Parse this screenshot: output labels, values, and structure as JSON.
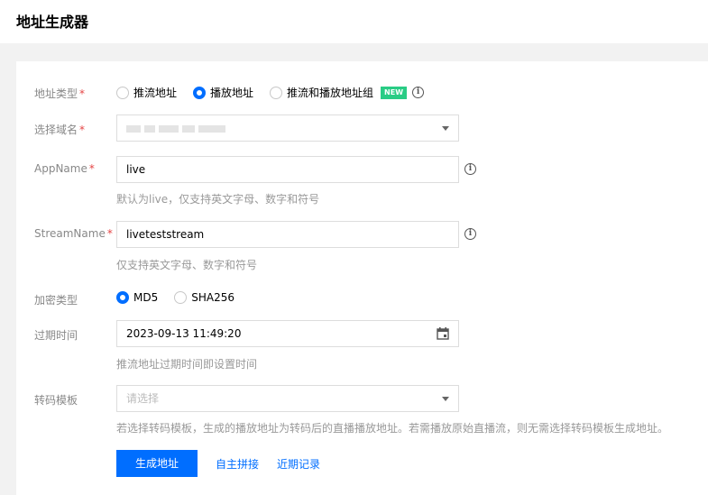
{
  "page": {
    "title": "地址生成器"
  },
  "form": {
    "address_type": {
      "label": "地址类型",
      "required_mark": "*",
      "options": [
        "推流地址",
        "播放地址",
        "推流和播放地址组"
      ],
      "selected": "播放地址",
      "new_badge": "NEW"
    },
    "domain": {
      "label": "选择域名",
      "required_mark": "*"
    },
    "app_name": {
      "label": "AppName",
      "required_mark": "*",
      "value": "live",
      "help": "默认为live，仅支持英文字母、数字和符号"
    },
    "stream_name": {
      "label": "StreamName",
      "required_mark": "*",
      "value": "liveteststream",
      "help": "仅支持英文字母、数字和符号"
    },
    "encryption": {
      "label": "加密类型",
      "options": [
        "MD5",
        "SHA256"
      ],
      "selected": "MD5"
    },
    "expire_time": {
      "label": "过期时间",
      "value": "2023-09-13 11:49:20",
      "help": "推流地址过期时间即设置时间"
    },
    "transcode_template": {
      "label": "转码模板",
      "placeholder": "请选择",
      "help": "若选择转码模板，生成的播放地址为转码后的直播播放地址。若需播放原始直播流，则无需选择转码模板生成地址。"
    }
  },
  "actions": {
    "generate": "生成地址",
    "custom_splice": "自主拼接",
    "recent_records": "近期记录"
  },
  "colors": {
    "accent": "#006eff",
    "new_badge": "#29cc85",
    "required": "#e54545"
  }
}
